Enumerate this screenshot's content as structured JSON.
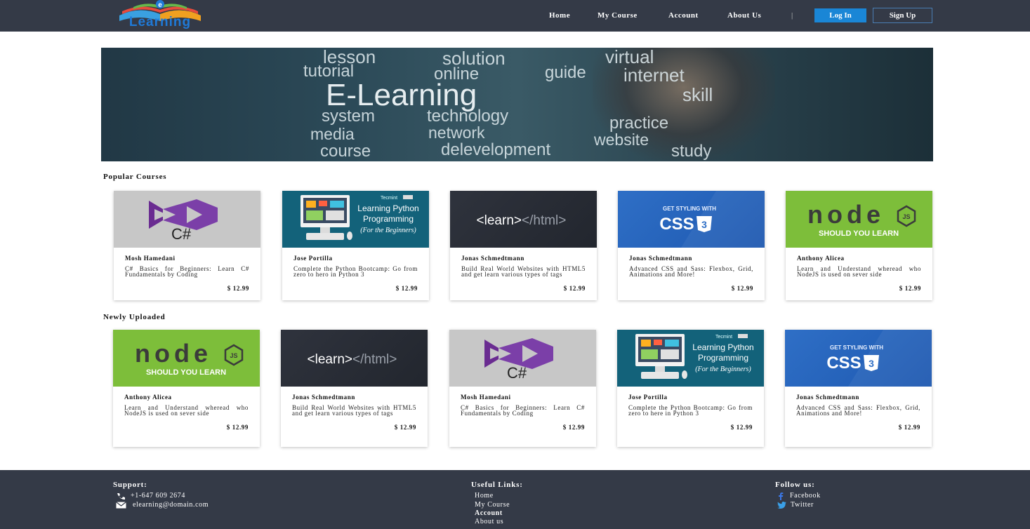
{
  "brand": {
    "logo_text": "Learning",
    "logo_letter": "e"
  },
  "nav": {
    "links": [
      "Home",
      "My Course",
      "Account",
      "About Us"
    ],
    "separator": "|",
    "login": "Log In",
    "signup": "Sign Up"
  },
  "hero": {
    "words": [
      "lesson",
      "solution",
      "virtual",
      "tutorial",
      "online",
      "guide",
      "internet",
      "E-Learning",
      "skill",
      "system",
      "technology",
      "practice",
      "media",
      "network",
      "website",
      "course",
      "delevelopment",
      "study"
    ]
  },
  "popular": {
    "title": "Popular Courses",
    "cards": [
      {
        "thumb": "csharp",
        "author": "Mosh Hamedani",
        "desc": "C# Basics for Beginners: Learn C# Fundamentals by Coding",
        "price": "$ 12.99"
      },
      {
        "thumb": "python",
        "author": "Jose Portilla",
        "desc": "Complete the Python Bootcamp: Go from zero to hero in Python 3",
        "price": "$ 12.99"
      },
      {
        "thumb": "html",
        "author": "Jonas Schmedtmann",
        "desc": "Build Real World Websites with HTML5 and get learn various types of tags",
        "price": "$ 12.99"
      },
      {
        "thumb": "css",
        "author": "Jonas Schmedtmann",
        "desc": "Advanced CSS and Sass: Flexbox, Grid, Animations and More!",
        "price": "$ 12.99"
      },
      {
        "thumb": "node",
        "author": "Anthony Alicea",
        "desc": "Learn and Understand wheread who NodeJS is used on sever side",
        "price": "$ 12.99"
      }
    ]
  },
  "newly": {
    "title": "Newly Uploaded",
    "cards": [
      {
        "thumb": "node",
        "author": "Anthony Alicea",
        "desc": "Learn and Understand wheread who NodeJS is used on sever side",
        "price": "$ 12.99"
      },
      {
        "thumb": "html",
        "author": "Jonas Schmedtmann",
        "desc": "Build Real World Websites with HTML5 and get learn various types of tags",
        "price": "$ 12.99"
      },
      {
        "thumb": "csharp",
        "author": "Mosh Hamedani",
        "desc": "C# Basics for Beginners: Learn C# Fundamentals by Coding",
        "price": "$ 12.99"
      },
      {
        "thumb": "python",
        "author": "Jose Portilla",
        "desc": "Complete the Python Bootcamp: Go from zero to here in Python 3",
        "price": "$ 12.99"
      },
      {
        "thumb": "css",
        "author": "Jonas Schmedtmann",
        "desc": "Advanced CSS and Sass: Flexbox, Grid, Animations and More!",
        "price": "$ 12.99"
      }
    ]
  },
  "thumbs": {
    "csharp_label": "C#",
    "python_brand": "Tecmint",
    "python_title1": "Learning Python",
    "python_title2": "Programming",
    "python_title3": "(For the Beginners)",
    "html_label1": "<learn>",
    "html_label2": "</html>",
    "css_top": "GET STYLING WITH",
    "css_main": "CSS",
    "css_badge": "3",
    "node_main": "node",
    "node_badge": "JS",
    "node_sub": "SHOULD YOU LEARN"
  },
  "footer": {
    "support_title": "Support:",
    "phone": "+1-647 609 2674",
    "email": "elearning@domain.com",
    "links_title": "Useful Links:",
    "links": [
      "Home",
      "My Course",
      "Account",
      "About us"
    ],
    "follow_title": "Follow us:",
    "facebook": "Facebook",
    "twitter": "Twitter"
  },
  "colors": {
    "navbar": "#343a47",
    "login_button": "#1a86d6",
    "footer": "#343a47"
  },
  "icons": [
    "phone-icon",
    "mail-icon",
    "facebook-icon",
    "twitter-icon"
  ]
}
